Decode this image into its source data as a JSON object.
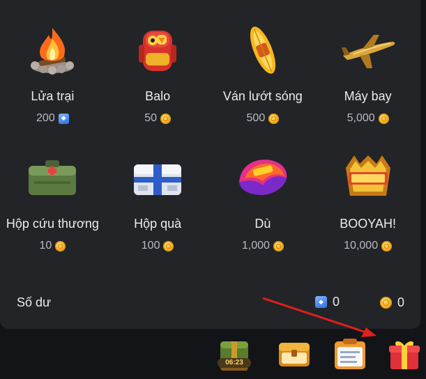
{
  "items": [
    {
      "name": "Lửa trại",
      "price": "200",
      "currency": "diamond",
      "icon": "campfire-icon"
    },
    {
      "name": "Balo",
      "price": "50",
      "currency": "coin",
      "icon": "backpack-icon"
    },
    {
      "name": "Ván lướt sóng",
      "price": "500",
      "currency": "coin",
      "icon": "surfboard-icon"
    },
    {
      "name": "Máy bay",
      "price": "5,000",
      "currency": "coin",
      "icon": "airplane-icon"
    },
    {
      "name": "Hộp cứu thương",
      "price": "10",
      "currency": "coin",
      "icon": "medkit-icon"
    },
    {
      "name": "Hộp quà",
      "price": "100",
      "currency": "coin",
      "icon": "gift-box-icon"
    },
    {
      "name": "Dù",
      "price": "1,000",
      "currency": "coin",
      "icon": "parachute-icon"
    },
    {
      "name": "BOOYAH!",
      "price": "10,000",
      "currency": "coin",
      "icon": "booyah-icon"
    }
  ],
  "balance": {
    "label": "Số dư",
    "diamonds": "0",
    "coins": "0"
  },
  "bottom_bar": {
    "timer": "06:23",
    "buttons": [
      "treasure-chest-icon",
      "golden-chest-icon",
      "calendar-board-icon",
      "gift-icon"
    ]
  },
  "colors": {
    "panel": "#232428",
    "background": "#131418",
    "coin": "#f5b320",
    "diamond": "#2e6fe0",
    "arrow": "#e0201c"
  }
}
